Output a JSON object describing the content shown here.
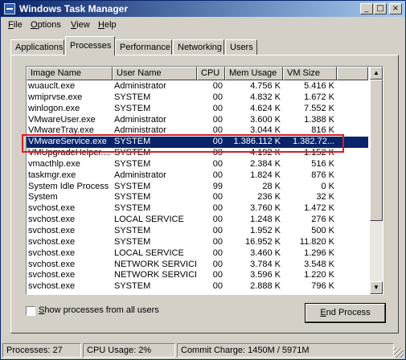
{
  "window": {
    "title": "Windows Task Manager"
  },
  "titlebar_buttons": {
    "minimize": "_",
    "maximize": "□",
    "close": "×"
  },
  "menu": [
    {
      "label": "File",
      "mnemonic": "F",
      "rest": "ile"
    },
    {
      "label": "Options",
      "mnemonic": "O",
      "rest": "ptions"
    },
    {
      "label": "View",
      "mnemonic": "V",
      "rest": "iew"
    },
    {
      "label": "Help",
      "mnemonic": "H",
      "rest": "elp"
    }
  ],
  "tabs": [
    {
      "label": "Applications",
      "active": false
    },
    {
      "label": "Processes",
      "active": true
    },
    {
      "label": "Performance",
      "active": false
    },
    {
      "label": "Networking",
      "active": false
    },
    {
      "label": "Users",
      "active": false
    }
  ],
  "columns": [
    "Image Name",
    "User Name",
    "CPU",
    "Mem Usage",
    "VM Size"
  ],
  "processes": [
    {
      "name": "wuauclt.exe",
      "user": "Administrator",
      "cpu": "00",
      "mem": "4.756 K",
      "vm": "5.416 K"
    },
    {
      "name": "wmiprvse.exe",
      "user": "SYSTEM",
      "cpu": "00",
      "mem": "4.832 K",
      "vm": "1.672 K"
    },
    {
      "name": "winlogon.exe",
      "user": "SYSTEM",
      "cpu": "00",
      "mem": "4.624 K",
      "vm": "7.552 K"
    },
    {
      "name": "VMwareUser.exe",
      "user": "Administrator",
      "cpu": "00",
      "mem": "3.600 K",
      "vm": "1.388 K"
    },
    {
      "name": "VMwareTray.exe",
      "user": "Administrator",
      "cpu": "00",
      "mem": "3.044 K",
      "vm": "816 K"
    },
    {
      "name": "VMwareService.exe",
      "user": "SYSTEM",
      "cpu": "00",
      "mem": "1.386.112 K",
      "vm": "1.382.72...",
      "selected": true
    },
    {
      "name": "VMUpgradeHelper....",
      "user": "SYSTEM",
      "cpu": "00",
      "mem": "4.192 K",
      "vm": "1.152 K"
    },
    {
      "name": "vmacthlp.exe",
      "user": "SYSTEM",
      "cpu": "00",
      "mem": "2.384 K",
      "vm": "516 K"
    },
    {
      "name": "taskmgr.exe",
      "user": "Administrator",
      "cpu": "00",
      "mem": "1.824 K",
      "vm": "876 K"
    },
    {
      "name": "System Idle Process",
      "user": "SYSTEM",
      "cpu": "99",
      "mem": "28 K",
      "vm": "0 K"
    },
    {
      "name": "System",
      "user": "SYSTEM",
      "cpu": "00",
      "mem": "236 K",
      "vm": "32 K"
    },
    {
      "name": "svchost.exe",
      "user": "SYSTEM",
      "cpu": "00",
      "mem": "3.760 K",
      "vm": "1.472 K"
    },
    {
      "name": "svchost.exe",
      "user": "LOCAL SERVICE",
      "cpu": "00",
      "mem": "1.248 K",
      "vm": "276 K"
    },
    {
      "name": "svchost.exe",
      "user": "SYSTEM",
      "cpu": "00",
      "mem": "1.952 K",
      "vm": "500 K"
    },
    {
      "name": "svchost.exe",
      "user": "SYSTEM",
      "cpu": "00",
      "mem": "16.952 K",
      "vm": "11.820 K"
    },
    {
      "name": "svchost.exe",
      "user": "LOCAL SERVICE",
      "cpu": "00",
      "mem": "3.460 K",
      "vm": "1.296 K"
    },
    {
      "name": "svchost.exe",
      "user": "NETWORK SERVICE",
      "cpu": "00",
      "mem": "3.784 K",
      "vm": "3.548 K"
    },
    {
      "name": "svchost.exe",
      "user": "NETWORK SERVICE",
      "cpu": "00",
      "mem": "3.596 K",
      "vm": "1.220 K"
    },
    {
      "name": "svchost.exe",
      "user": "SYSTEM",
      "cpu": "00",
      "mem": "2.888 K",
      "vm": "796 K"
    }
  ],
  "show_all_users": {
    "label": "Show processes from all users",
    "mnemonic": "S",
    "rest": "how processes from all users",
    "checked": false
  },
  "end_process": {
    "label": "End Process",
    "mnemonic": "E",
    "rest": "nd Process"
  },
  "status": {
    "processes": "Processes: 27",
    "cpu": "CPU Usage: 2%",
    "commit": "Commit Charge: 1450M / 5971M"
  },
  "colors": {
    "selection": "#0a246a",
    "highlight_box": "#e01b24",
    "face": "#d4d0c8"
  }
}
